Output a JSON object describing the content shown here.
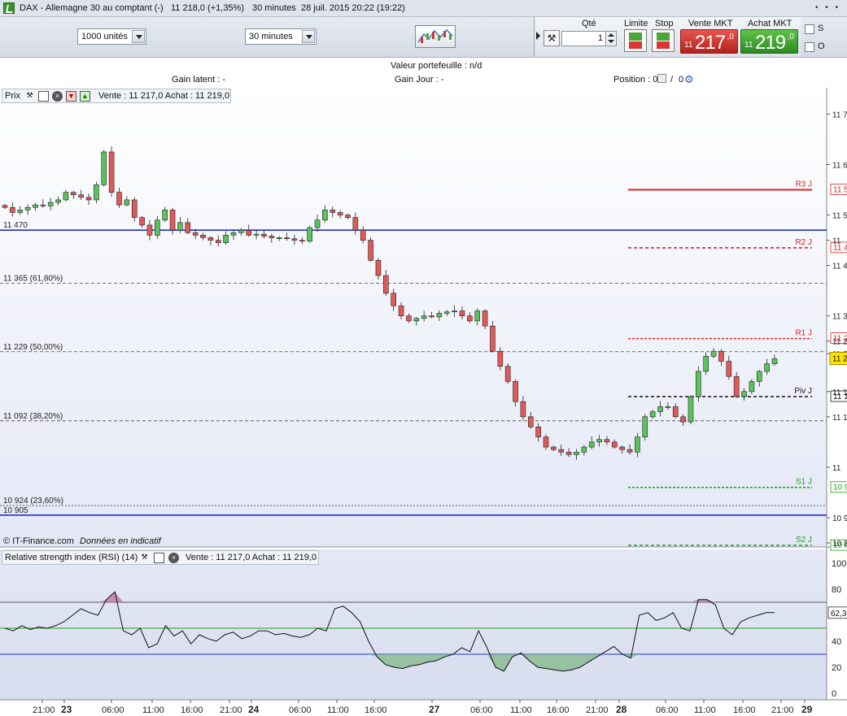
{
  "title_bar": {
    "instrument": "DAX - Allemagne 30 au comptant (-)",
    "price_change": "11 218,0 (+1,35%)",
    "timeframe": "30 minutes",
    "datetime": "28 juil. 2015 20:22 (19:22)"
  },
  "toolbar": {
    "size_select": "1000 unités",
    "timeframe_select": "30 minutes",
    "qty_label": "Qté",
    "qty_value": "1",
    "limit_label": "Limite",
    "stop_label": "Stop",
    "sell_label": "Vente MKT",
    "buy_label": "Achat MKT",
    "sell_price_prefix": "11",
    "sell_price_main": "217",
    "sell_price_decimal": ",0",
    "buy_price_prefix": "11",
    "buy_price_main": "219",
    "buy_price_decimal": ",0",
    "checkbox_s": "S",
    "checkbox_o": "O"
  },
  "info_bar": {
    "portfolio_value": "Valeur portefeuille : n/d",
    "latent_gain": "Gain latent : -",
    "day_gain": "Gain Jour : -",
    "position_label": "Position : 0",
    "position_separator": "/",
    "position_value2": "0"
  },
  "price_panel": {
    "label": "Prix",
    "quote": "Vente : 11 217,0 Achat : 11 219,0",
    "footer": "© IT-Finance.com",
    "footer_italic": "Données en indicatif"
  },
  "rsi_panel": {
    "label": "Relative strength index (RSI) (14)",
    "quote": "Vente : 11 217,0 Achat : 11 219,0",
    "current_value": "62,3"
  },
  "colors": {
    "bull": "#5cc25c",
    "bear": "#e05a5a",
    "pivot_resistance": "#dd2222",
    "pivot_support": "#22a022",
    "horizontal_line": "#2233cc",
    "chart_bg_top": "#ffffff",
    "chart_bg_bottom": "#e6eaf7"
  },
  "chart_data": [
    {
      "type": "candlestick",
      "title": "DAX 30 minutes",
      "ylim": [
        10850,
        11720
      ],
      "y_ticks_right": [
        "11 7",
        "11 6",
        "11 5",
        "11",
        "11 4",
        "11 3",
        "11 2",
        "11 2",
        "11 1",
        "11 1",
        "11",
        "10 9",
        "10 8"
      ],
      "x_ticks": [
        "21:00",
        "23",
        "06:00",
        "11:00",
        "16:00",
        "21:00",
        "24",
        "06:00",
        "11:00",
        "16:00",
        "27",
        "06:00",
        "11:00",
        "16:00",
        "21:00",
        "28",
        "06:00",
        "11:00",
        "16:00",
        "21:00",
        "29"
      ],
      "horizontal_lines": [
        {
          "label": "11 470",
          "value": 11470,
          "style": "solid"
        },
        {
          "label": "11 365 (61,80%)",
          "value": 11365,
          "style": "dashed"
        },
        {
          "label": "11 229 (50,00%)",
          "value": 11229,
          "style": "dashed"
        },
        {
          "label": "11 092 (38,20%)",
          "value": 11092,
          "style": "dashed"
        },
        {
          "label": "10 924 (23,60%)",
          "value": 10924,
          "style": "dotted"
        },
        {
          "label": "10 905",
          "value": 10905,
          "style": "solid"
        }
      ],
      "pivots": [
        {
          "label": "R3 J",
          "value": 11550,
          "side_label": "11 5"
        },
        {
          "label": "R2 J",
          "value": 11435,
          "side_label": "11 4"
        },
        {
          "label": "R1 J",
          "value": 11255,
          "side_label": "11 2"
        },
        {
          "label": "Piv J",
          "value": 11140,
          "side_label": "11 1"
        },
        {
          "label": "S1 J",
          "value": 10960,
          "side_label": "10 9"
        },
        {
          "label": "S2 J",
          "value": 10845,
          "side_label": "10 8"
        }
      ],
      "current_price_tag": "11 2",
      "close_path": [
        11515,
        11505,
        11510,
        11515,
        11520,
        11518,
        11525,
        11530,
        11545,
        11540,
        11535,
        11530,
        11560,
        11625,
        11545,
        11520,
        11530,
        11495,
        11480,
        11460,
        11490,
        11510,
        11470,
        11485,
        11465,
        11460,
        11455,
        11450,
        11445,
        11460,
        11465,
        11470,
        11460,
        11462,
        11458,
        11455,
        11455,
        11453,
        11450,
        11448,
        11475,
        11490,
        11510,
        11505,
        11500,
        11495,
        11470,
        11450,
        11410,
        11380,
        11345,
        11320,
        11300,
        11290,
        11295,
        11300,
        11298,
        11305,
        11308,
        11310,
        11300,
        11290,
        11310,
        11280,
        11230,
        11200,
        11170,
        11130,
        11100,
        11080,
        11060,
        11040,
        11035,
        11030,
        11025,
        11030,
        11040,
        11050,
        11055,
        11050,
        11040,
        11035,
        11030,
        11060,
        11100,
        11110,
        11120,
        11120,
        11100,
        11090,
        11140,
        11190,
        11220,
        11230,
        11210,
        11180,
        11140,
        11150,
        11170,
        11190,
        11205,
        11215
      ]
    },
    {
      "type": "line",
      "title": "Relative strength index (RSI) (14)",
      "ylim": [
        0,
        100
      ],
      "y_ticks": [
        "0",
        "20",
        "40",
        "60",
        "80",
        "100"
      ],
      "levels": [
        30,
        50,
        70
      ],
      "values": [
        50,
        48,
        52,
        49,
        51,
        50,
        52,
        55,
        60,
        65,
        62,
        60,
        72,
        78,
        48,
        45,
        50,
        35,
        38,
        52,
        44,
        48,
        38,
        45,
        42,
        40,
        45,
        47,
        42,
        44,
        48,
        48,
        45,
        46,
        44,
        43,
        45,
        50,
        48,
        65,
        67,
        62,
        55,
        40,
        28,
        22,
        20,
        19,
        21,
        22,
        24,
        25,
        28,
        30,
        35,
        32,
        48,
        35,
        20,
        17,
        28,
        31,
        25,
        20,
        19,
        18,
        17,
        18,
        20,
        24,
        28,
        32,
        36,
        30,
        27,
        60,
        62,
        56,
        58,
        62,
        50,
        48,
        72,
        72,
        68,
        50,
        45,
        55,
        58,
        60,
        62,
        62
      ]
    }
  ]
}
